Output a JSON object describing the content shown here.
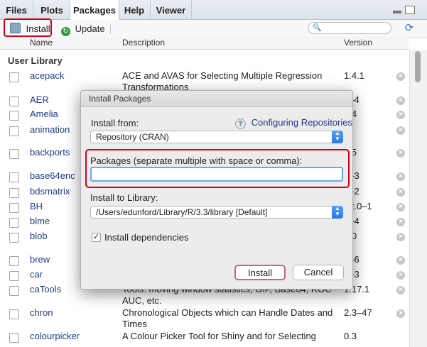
{
  "tabs": [
    "Files",
    "Plots",
    "Packages",
    "Help",
    "Viewer"
  ],
  "toolbar": {
    "install": "Install",
    "update": "Update"
  },
  "columns": {
    "name": "Name",
    "description": "Description",
    "version": "Version"
  },
  "section_title": "User Library",
  "packages": [
    {
      "name": "acepack",
      "description": "ACE and AVAS for Selecting Multiple Regression Transformations",
      "version": "1.4.1"
    },
    {
      "name": "AER",
      "description": "",
      "version": "2–4"
    },
    {
      "name": "Amelia",
      "description": "",
      "version": "7.4"
    },
    {
      "name": "animation",
      "description": "",
      "version": "4"
    },
    {
      "name": "backports",
      "description": "",
      "version": "0.5"
    },
    {
      "name": "base64enc",
      "description": "",
      "version": "1–3"
    },
    {
      "name": "bdsmatrix",
      "description": "",
      "version": "3–2"
    },
    {
      "name": "BH",
      "description": "",
      "version": "62.0–1"
    },
    {
      "name": "blme",
      "description": "",
      "version": "0–4"
    },
    {
      "name": "blob",
      "description": "",
      "version": "0.0"
    },
    {
      "name": "brew",
      "description": "",
      "version": "0–6"
    },
    {
      "name": "car",
      "description": "",
      "version": "1–3"
    },
    {
      "name": "caTools",
      "description": "Tools: moving window statistics, GIF, Base64, ROC AUC, etc.",
      "version": "1.17.1"
    },
    {
      "name": "chron",
      "description": "Chronological Objects which can Handle Dates and Times",
      "version": "2.3–47"
    },
    {
      "name": "colourpicker",
      "description": "A Colour Picker Tool for Shiny and for Selecting",
      "version": "0.3"
    }
  ],
  "dialog": {
    "title": "Install Packages",
    "install_from_label": "Install from:",
    "help_link": "Configuring Repositories",
    "install_from_value": "Repository (CRAN)",
    "packages_label": "Packages (separate multiple with space or comma):",
    "packages_value": "",
    "library_label": "Install to Library:",
    "library_value": "/Users/edunford/Library/R/3.3/library [Default]",
    "dependencies_label": "Install dependencies",
    "dependencies_checked": true,
    "install_button": "Install",
    "cancel_button": "Cancel"
  },
  "colors": {
    "highlight": "#d0021b",
    "link": "#1e3a8a",
    "accent": "#2a74e6"
  }
}
